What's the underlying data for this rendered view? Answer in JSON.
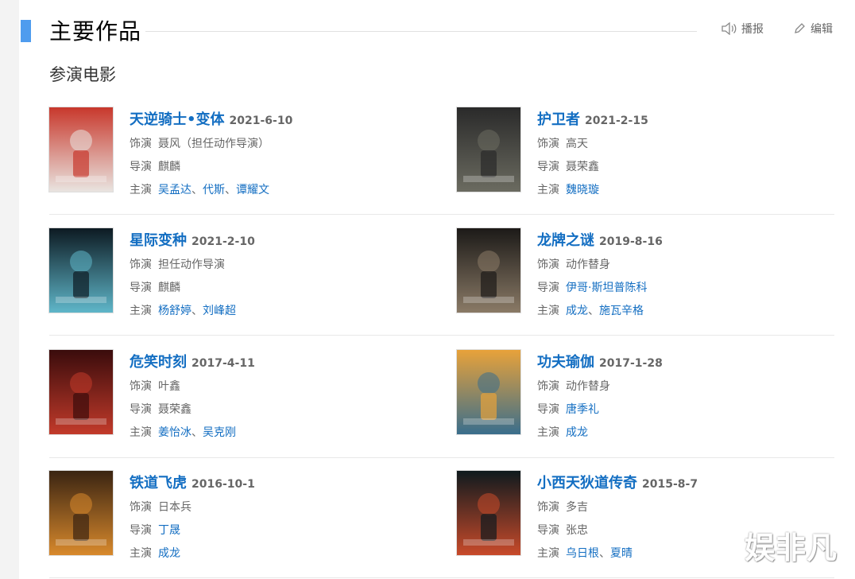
{
  "section": {
    "title": "主要作品",
    "subsection": "参演电影",
    "actions": {
      "report": "播报",
      "edit": "编辑"
    }
  },
  "films": [
    {
      "title": "天逆骑士•变体",
      "date": "2021-6-10",
      "role_label": "饰演",
      "role": "聂风（担任动作导演）",
      "director_label": "导演",
      "director": "麒麟",
      "director_is_link": false,
      "cast_label": "主演",
      "cast": [
        "吴孟达",
        "代斯",
        "谭耀文"
      ],
      "poster_icon": "poster-ceremony",
      "poster_colors": [
        "#c8382c",
        "#e9e4e0"
      ]
    },
    {
      "title": "护卫者",
      "date": "2021-2-15",
      "role_label": "饰演",
      "role": "高天",
      "director_label": "导演",
      "director": "聂荣鑫",
      "director_is_link": false,
      "cast_label": "主演",
      "cast": [
        "魏晓璇"
      ],
      "poster_icon": "poster-dark-figure",
      "poster_colors": [
        "#2a2a2a",
        "#6b6b60"
      ]
    },
    {
      "title": "星际变种",
      "date": "2021-2-10",
      "role_label": "饰演",
      "role": "担任动作导演",
      "director_label": "导演",
      "director": "麒麟",
      "director_is_link": false,
      "cast_label": "主演",
      "cast": [
        "杨舒婷",
        "刘峰超"
      ],
      "poster_icon": "poster-variant",
      "poster_colors": [
        "#0d1a22",
        "#5fb6c9"
      ]
    },
    {
      "title": "龙牌之谜",
      "date": "2019-8-16",
      "role_label": "饰演",
      "role": "动作替身",
      "director_label": "导演",
      "director": "伊哥·斯坦普陈科",
      "director_is_link": true,
      "cast_label": "主演",
      "cast": [
        "成龙",
        "施瓦辛格"
      ],
      "poster_icon": "poster-dragon",
      "poster_colors": [
        "#1c1a18",
        "#8a7a66"
      ]
    },
    {
      "title": "危笑时刻",
      "date": "2017-4-11",
      "role_label": "饰演",
      "role": "叶鑫",
      "director_label": "导演",
      "director": "聂荣鑫",
      "director_is_link": false,
      "cast_label": "主演",
      "cast": [
        "姜怡冰",
        "吴克刚"
      ],
      "poster_icon": "poster-red-cast",
      "poster_colors": [
        "#3a0c0c",
        "#c23a2a"
      ]
    },
    {
      "title": "功夫瑜伽",
      "date": "2017-1-28",
      "role_label": "饰演",
      "role": "动作替身",
      "director_label": "导演",
      "director": "唐季礼",
      "director_is_link": true,
      "cast_label": "主演",
      "cast": [
        "成龙"
      ],
      "poster_icon": "poster-kungfu-yoga",
      "poster_colors": [
        "#e8a23a",
        "#3a6e8c"
      ]
    },
    {
      "title": "铁道飞虎",
      "date": "2016-10-1",
      "role_label": "饰演",
      "role": "日本兵",
      "director_label": "导演",
      "director": "丁晟",
      "director_is_link": true,
      "cast_label": "主演",
      "cast": [
        "成龙"
      ],
      "poster_icon": "poster-railroad-tigers",
      "poster_colors": [
        "#3a2412",
        "#d8892c"
      ]
    },
    {
      "title": "小西天狄道传奇",
      "date": "2015-8-7",
      "role_label": "饰演",
      "role": "多吉",
      "director_label": "导演",
      "director": "张忠",
      "director_is_link": false,
      "cast_label": "主演",
      "cast": [
        "乌日根",
        "夏晴"
      ],
      "poster_icon": "poster-legend",
      "poster_colors": [
        "#0f1a1e",
        "#c84a2a"
      ]
    }
  ],
  "watermark": "娱非凡"
}
